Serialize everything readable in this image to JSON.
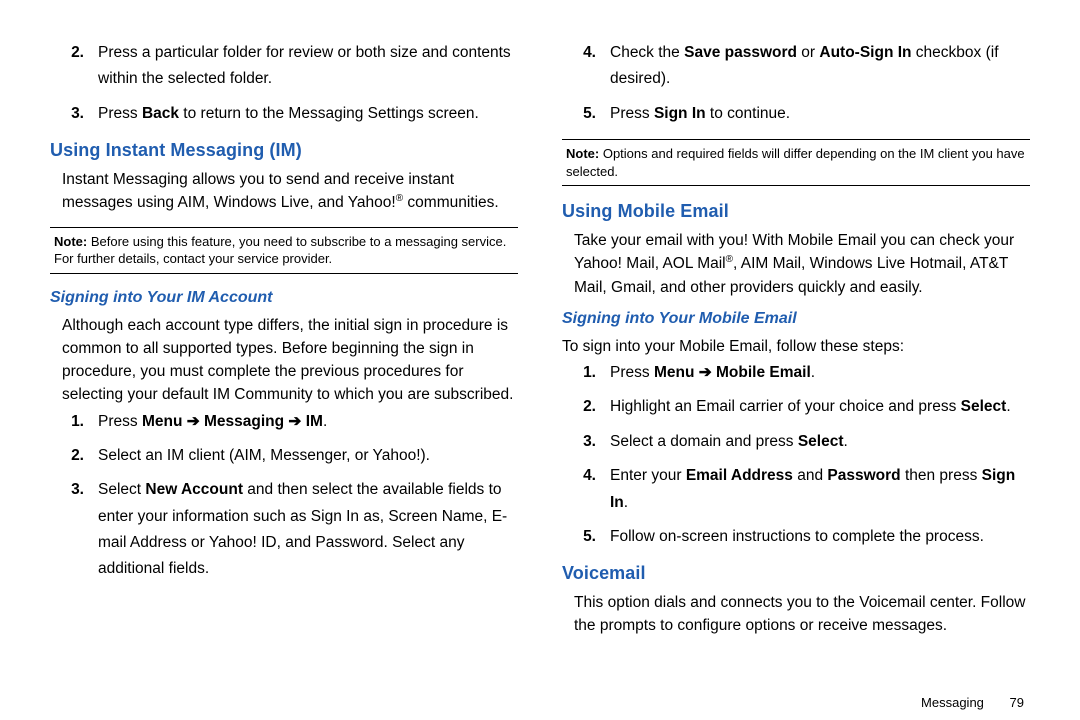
{
  "left": {
    "ol1": [
      {
        "n": "2.",
        "t": "Press a particular folder for review or both size and contents within the selected folder."
      },
      {
        "n": "3.",
        "pre": "Press ",
        "b1": "Back",
        "post": " to return to the Messaging Settings screen."
      }
    ],
    "h2_im": "Using Instant Messaging (IM)",
    "p_im_pre": "Instant Messaging allows you to send and receive instant messages using AIM, Windows Live, and Yahoo!",
    "p_im_post": " communities.",
    "note1_label": "Note:",
    "note1_text": " Before using this feature, you need to subscribe to a messaging service. For further details, contact your service provider.",
    "h3_signin": "Signing into Your IM Account",
    "p_signin": "Although each account type differs, the initial sign in procedure is common to all supported types. Before beginning the sign in procedure, you must complete the previous procedures for selecting your default IM Community to which you are subscribed.",
    "ol2": [
      {
        "n": "1.",
        "pre": "Press ",
        "b1": "Menu ➔ Messaging ➔ IM",
        "post": "."
      },
      {
        "n": "2.",
        "t": "Select an IM client (AIM, Messenger, or Yahoo!)."
      },
      {
        "n": "3.",
        "pre": "Select ",
        "b1": "New Account",
        "post": " and then select the available fields to enter your information such as Sign In as, Screen Name, E-mail Address or Yahoo! ID, and Password. Select any additional fields."
      }
    ]
  },
  "right": {
    "ol1": [
      {
        "n": "4.",
        "pre": "Check the ",
        "b1": "Save password",
        "mid": " or ",
        "b2": "Auto-Sign In",
        "post": " checkbox (if desired)."
      },
      {
        "n": "5.",
        "pre": "Press ",
        "b1": "Sign In",
        "post": " to continue."
      }
    ],
    "note2_label": "Note:",
    "note2_text": " Options and required fields will differ depending on the IM client you have selected.",
    "h2_email": "Using Mobile Email",
    "p_email_pre": "Take your email with you! With Mobile Email you can check your Yahoo! Mail, AOL Mail",
    "p_email_post": ", AIM Mail, Windows Live Hotmail, AT&T Mail, Gmail, and other providers quickly and easily.",
    "h3_signin_email": "Signing into Your Mobile Email",
    "p_signin_email": "To sign into your Mobile Email, follow these steps:",
    "ol2": [
      {
        "n": "1.",
        "pre": "Press ",
        "b1": "Menu ➔ Mobile Email",
        "post": "."
      },
      {
        "n": "2.",
        "pre": "Highlight an Email carrier of your choice and press ",
        "b1": "Select",
        "post": "."
      },
      {
        "n": "3.",
        "pre": "Select a domain and press ",
        "b1": "Select",
        "post": "."
      },
      {
        "n": "4.",
        "pre": "Enter your ",
        "b1": "Email Address",
        "mid": " and ",
        "b2": "Password",
        "mid2": " then press ",
        "b3": "Sign In",
        "post": "."
      },
      {
        "n": "5.",
        "t": "Follow on-screen instructions to complete the process."
      }
    ],
    "h2_vm": "Voicemail",
    "p_vm": "This option dials and connects you to the Voicemail center. Follow the prompts to configure options or receive messages."
  },
  "footer": {
    "section": "Messaging",
    "page": "79"
  }
}
